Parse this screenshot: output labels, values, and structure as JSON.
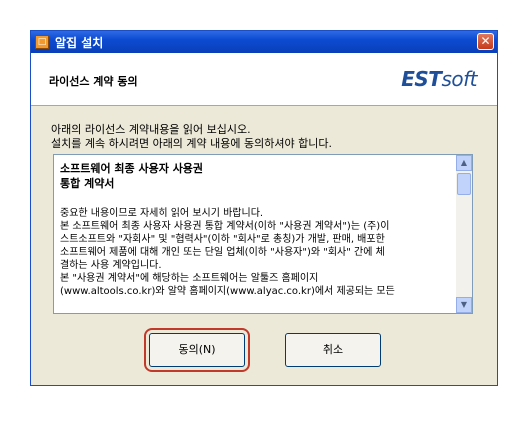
{
  "window": {
    "title": "알집 설치",
    "close_glyph": "✕",
    "app_icon_glyph": "□"
  },
  "header": {
    "title": "라이선스 계약 동의",
    "brand": "EST",
    "brand_soft": "soft"
  },
  "instructions": {
    "line1": "아래의 라이선스 계약내용을 읽어 보십시오.",
    "line2": "설치를 계속 하시려면 아래의 계약 내용에 동의하셔야 합니다."
  },
  "license": {
    "heading1": "소프트웨어 최종 사용자 사용권",
    "heading2": "통합 계약서",
    "lines": [
      "중요한 내용이므로 자세히 읽어 보시기 바랍니다.",
      "본 소프트웨어 최종 사용자 사용권 통합 계약서(이하 \"사용권 계약서\")는 (주)이",
      "스트소프트와 \"자회사\" 및 \"협력사\"(이하 \"회사\"로 총칭)가 개발, 판매, 배포한",
      "소프트웨어 제품에 대해 개인 또는 단일 업체(이하 \"사용자\")와 \"회사\" 간에 체",
      "결하는 사용 계약입니다.",
      "본 \"사용권 계약서\"에 해당하는 소프트웨어는 알툴즈 홈페이지",
      "(www.altools.co.kr)와 알약 홈페이지(www.alyac.co.kr)에서 제공되는 모든"
    ]
  },
  "buttons": {
    "agree": "동의(N)",
    "cancel": "취소"
  },
  "scroll": {
    "up_glyph": "▲",
    "down_glyph": "▼"
  }
}
